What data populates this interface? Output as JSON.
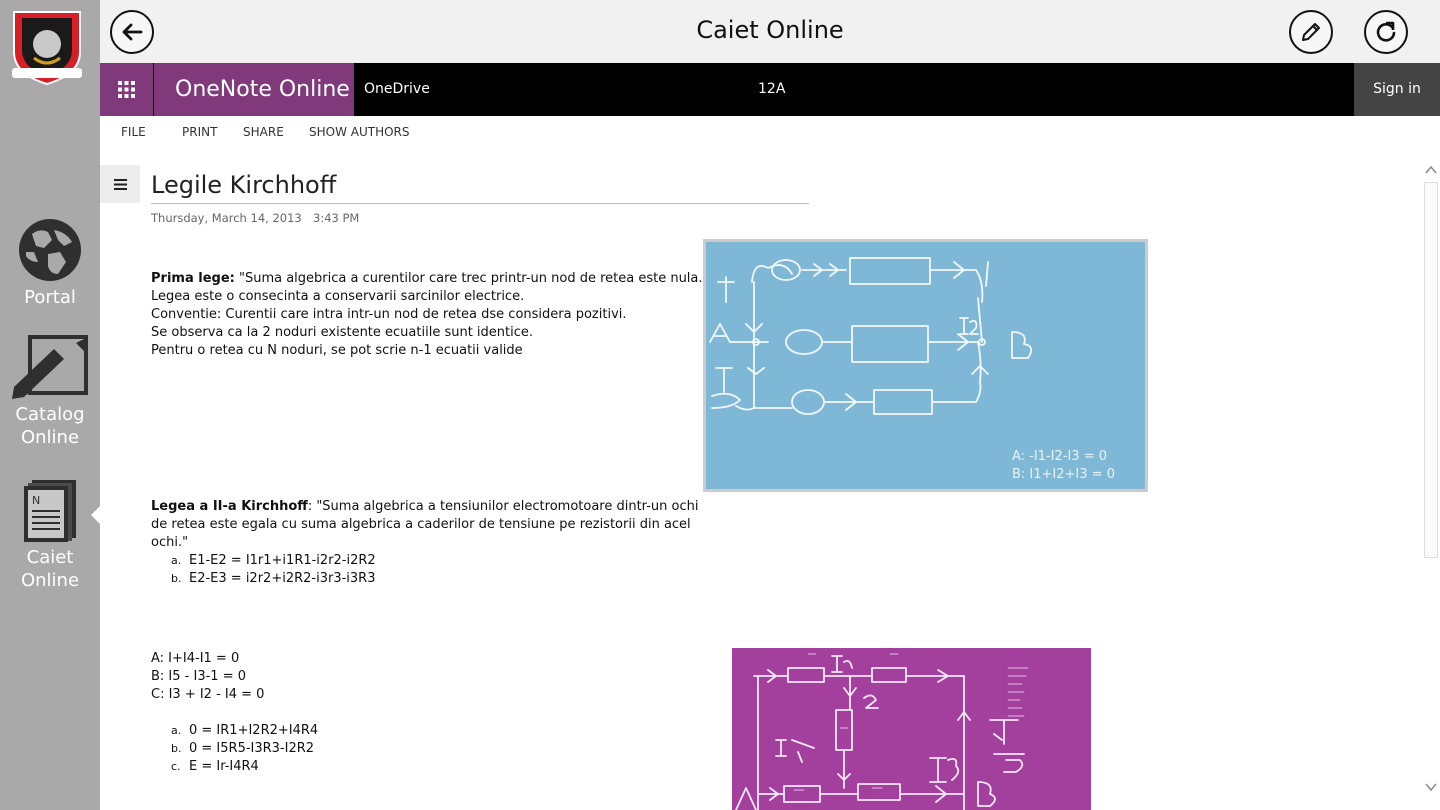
{
  "app": {
    "title": "Caiet Online"
  },
  "rail": {
    "items": [
      {
        "label": "Portal",
        "icon": "globe-icon"
      },
      {
        "label": "Catalog\nOnline",
        "icon": "pencil-notepad-icon"
      },
      {
        "label": "Caiet\nOnline",
        "icon": "notebook-icon"
      }
    ],
    "logo_icon": "school-crest-icon"
  },
  "suite": {
    "brand": "OneNote Online",
    "onedrive": "OneDrive",
    "notebook": "12A",
    "signin": "Sign in"
  },
  "ribbon": {
    "tabs": [
      "FILE",
      "PRINT",
      "SHARE",
      "SHOW AUTHORS"
    ]
  },
  "page": {
    "title": "Legile Kirchhoff",
    "date": "Thursday, March 14, 2013",
    "time": "3:43 PM",
    "law1": {
      "heading": "Prima lege:",
      "quote": " \"Suma algebrica a curentilor care trec printr-un nod de retea este nula.\"",
      "lines": [
        "Legea este o consecinta a conservarii sarcinilor electrice.",
        "Conventie: Curentii care intra intr-un nod de retea dse considera pozitivi.",
        "Se observa ca la 2 noduri existente ecuatiile sunt identice.",
        "Pentru o retea cu N noduri, se pot scrie n-1 ecuatii valide"
      ]
    },
    "law2": {
      "heading": "Legea a II-a Kirchhoff",
      "quote_lines": [
        ": \"Suma algebrica a tensiunilor electromotoare dintr-un ochi",
        "de retea este egala cu suma algebrica a caderilor de tensiune pe rezistorii din acel",
        "ochi.\""
      ],
      "items": [
        {
          "marker": "a.",
          "text": "E1-E2 = I1r1+i1R1-i2r2-i2R2"
        },
        {
          "marker": "b.",
          "text": "E2-E3 = i2r2+i2R2-i3r3-i3R3"
        }
      ]
    },
    "nodes": {
      "lines": [
        "A: I+I4-I1 = 0",
        "B: I5 - I3-1 = 0",
        "C: I3 + I2 - I4 = 0"
      ],
      "items": [
        {
          "marker": "a.",
          "text": "0 = IR1+I2R2+I4R4"
        },
        {
          "marker": "b.",
          "text": "0 = I5R5-I3R3-I2R2"
        },
        {
          "marker": "c.",
          "text": "E = Ir-I4R4"
        }
      ]
    },
    "image1": {
      "captions": [
        "A: -I1-I2-I3 = 0",
        "B: I1+I2+I3 = 0"
      ],
      "bg": "#7fb8d6"
    },
    "image2": {
      "bg": "#a33f9c"
    }
  },
  "colors": {
    "brand_purple": "#80397b",
    "rail_gray": "#a9a9a9",
    "suite_black": "#000000"
  }
}
